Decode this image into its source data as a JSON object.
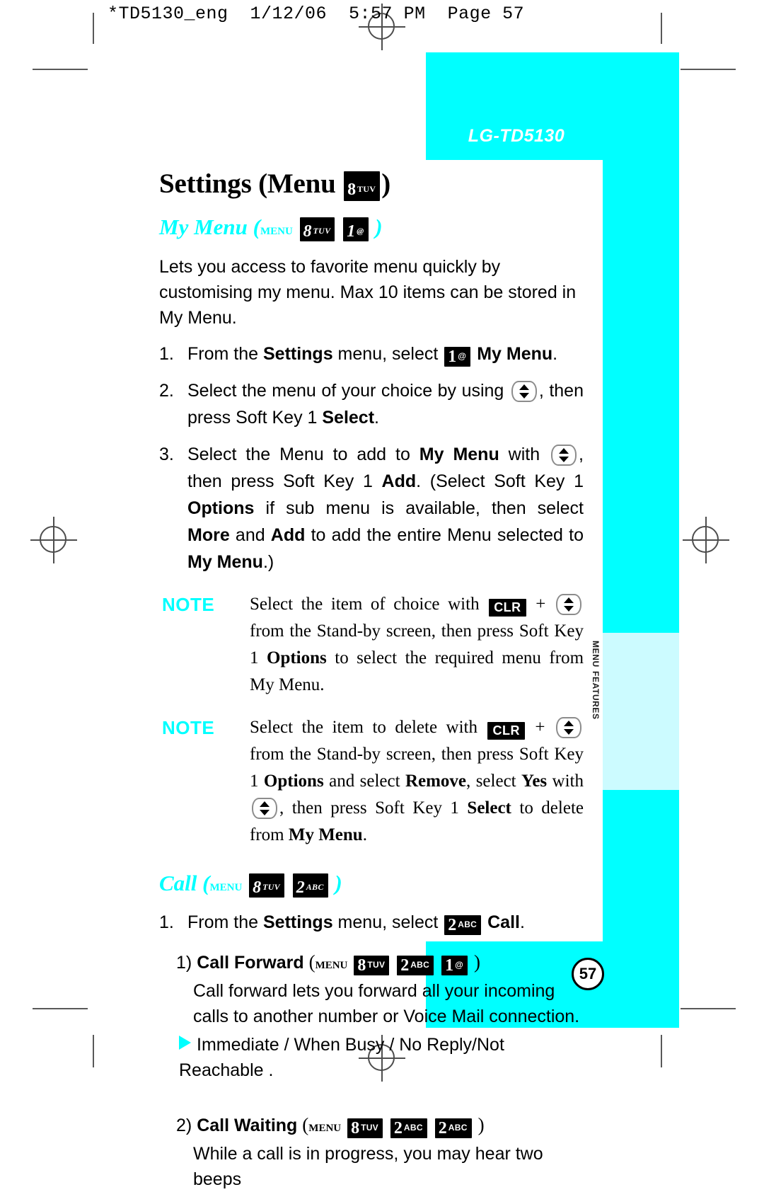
{
  "prepress": {
    "header": "*TD5130_eng  1/12/06  5:57 PM  Page 57"
  },
  "brand": {
    "model": "LG-TD5130"
  },
  "side_tab": {
    "label": "Menu Features"
  },
  "page": {
    "number": "57"
  },
  "colors": {
    "accent_cyan": "#00FFFF",
    "tab_cyan": "#CCFBFF",
    "text": "#000000",
    "crop_mark": "#595959"
  },
  "title": {
    "text_before": "Settings (Menu ",
    "text_after": ")"
  },
  "keys": {
    "k8": {
      "digit": "8",
      "sup": "TUV"
    },
    "k1": {
      "digit": "1",
      "sup": "@"
    },
    "k2": {
      "digit": "2",
      "sup": "ABC"
    },
    "clr": {
      "label": "CLR"
    },
    "nav": {
      "name": "up-down-navigation-key"
    }
  },
  "section_my_menu": {
    "heading_name": "My Menu",
    "heading_menu_word": "Menu",
    "intro": "Lets you access to favorite menu quickly by customising my menu. Max 10 items can be stored in My Menu.",
    "steps": [
      {
        "number": "1.",
        "p1": "From the ",
        "b1": "Settings",
        "p2": " menu, select ",
        "b2": "My Menu",
        "p3": "."
      },
      {
        "number": "2.",
        "p1": "Select the menu of your choice by using ",
        "p2": ", then press Soft Key 1 ",
        "b1": "Select",
        "p3": "."
      },
      {
        "number": "3.",
        "p1": "Select the Menu to add to ",
        "b1": "My Menu",
        "p2": " with ",
        "p3": ", then press Soft Key 1 ",
        "b2": "Add",
        "p4": ". (Select Soft Key 1 ",
        "b3": "Options",
        "p5": " if sub menu is available, then select ",
        "b4": "More",
        "p6": " and ",
        "b5": "Add",
        "p7": " to add the entire Menu selected to ",
        "b6": "My Menu",
        "p8": ".)"
      }
    ],
    "notes": [
      {
        "label": "NOTE",
        "p1": "Select the item of choice with ",
        "p2": " + ",
        "p3": " from the Stand-by screen, then press Soft Key 1 ",
        "b1": "Options",
        "p4": " to select the required menu from My Menu."
      },
      {
        "label": "NOTE",
        "p1": "Select the item to delete with ",
        "p2": " + ",
        "p3": " from the Stand-by screen, then press Soft Key 1 ",
        "b1": "Options",
        "p4": " and select ",
        "b2": "Remove",
        "p5": ", select ",
        "b3": "Yes",
        "p6": " with ",
        "p7": ", then press Soft Key 1 ",
        "b4": "Select",
        "p8": " to delete from ",
        "b5": "My Menu",
        "p9": "."
      }
    ]
  },
  "section_call": {
    "heading_name": "Call",
    "heading_menu_word": "Menu",
    "step": {
      "number": "1.",
      "p1": "From the ",
      "b1": "Settings",
      "p2": " menu, select ",
      "b2": "Call",
      "p3": "."
    },
    "items": [
      {
        "number": "1)",
        "title": "Call Forward",
        "menu_word": "Menu",
        "description": "Call forward lets you forward all your incoming calls to another number or Voice Mail connection.",
        "bullet": "Immediate / When Busy / No Reply/Not Reachable ."
      },
      {
        "number": "2)",
        "title": "Call Waiting",
        "menu_word": "Menu",
        "description": "While a call is in progress, you may hear two beeps"
      }
    ]
  }
}
